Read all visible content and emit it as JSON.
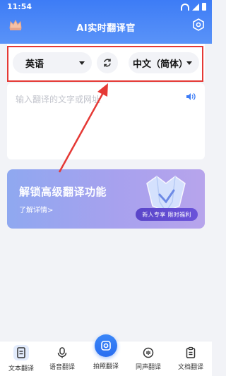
{
  "status_bar": {
    "time": "11:54"
  },
  "header": {
    "title": "AI实时翻译官"
  },
  "language_selector": {
    "source": "英语",
    "target": "中文（简体）"
  },
  "input": {
    "placeholder": "输入翻译的文字或网址"
  },
  "promo": {
    "title": "解锁高级翻译功能",
    "link": "了解详情>",
    "badge": "新人专享 限时福利"
  },
  "bottom_nav": {
    "items": [
      {
        "label": "文本翻译",
        "icon": "document-text-icon"
      },
      {
        "label": "语音翻译",
        "icon": "microphone-icon"
      },
      {
        "label": "拍照翻译",
        "icon": "camera-icon"
      },
      {
        "label": "同声翻译",
        "icon": "simultaneous-icon"
      },
      {
        "label": "文档翻译",
        "icon": "file-doc-icon"
      }
    ]
  },
  "colors": {
    "header": "#3d7cf6",
    "accent": "#2a6ef0",
    "highlight": "#e53935",
    "promo": "#a7a1ee"
  }
}
